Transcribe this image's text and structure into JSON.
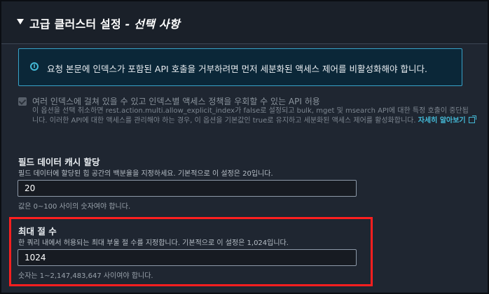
{
  "section": {
    "title": "고급 클러스터 설정",
    "title_suffix": " - 선택 사항"
  },
  "info": {
    "text": "요청 본문에 인덱스가 포함된 API 호출을 거부하려면 먼저 세분화된 액세스 제어를 비활성화해야 합니다."
  },
  "allow_index": {
    "label": "여러 인덱스에 걸쳐 있을 수 있고 인덱스별 액세스 정책을 우회할 수 있는 API 허용",
    "checked": true,
    "description": "이 옵션을 선택 취소하면 rest.action.multi.allow_explicit_index가 false로 설정되고 bulk, mget 및 msearch API에 대한 특정 호출이 중단됩니다. 이러한 API에 대한 액세스를 관리해야 하는 경우, 이 옵션을 기본값인 true로 유지하고 세분화된 액세스 제어를 활성화합니다.",
    "link_text": "자세히 알아보기"
  },
  "fielddata": {
    "label": "필드 데이터 캐시 할당",
    "description": "필드 데이터에 할당된 힙 공간의 백분율을 지정하세요. 기본적으로 이 설정은 20입니다.",
    "value": "20",
    "hint": "값은 0~100 사이의 숫자여야 합니다."
  },
  "max_clause": {
    "label": "최대 절 수",
    "description": "한 쿼리 내에서 허용되는 최대 부울 절 수를 지정합니다. 기본적으로 이 설정은 1,024입니다.",
    "value": "1024",
    "hint": "숫자는 1~2,147,483,647 사이여야 합니다."
  },
  "colors": {
    "background": "#1f2631",
    "info_border": "#37a2c8",
    "link": "#44b9d6",
    "highlight": "#ff1f1f"
  }
}
